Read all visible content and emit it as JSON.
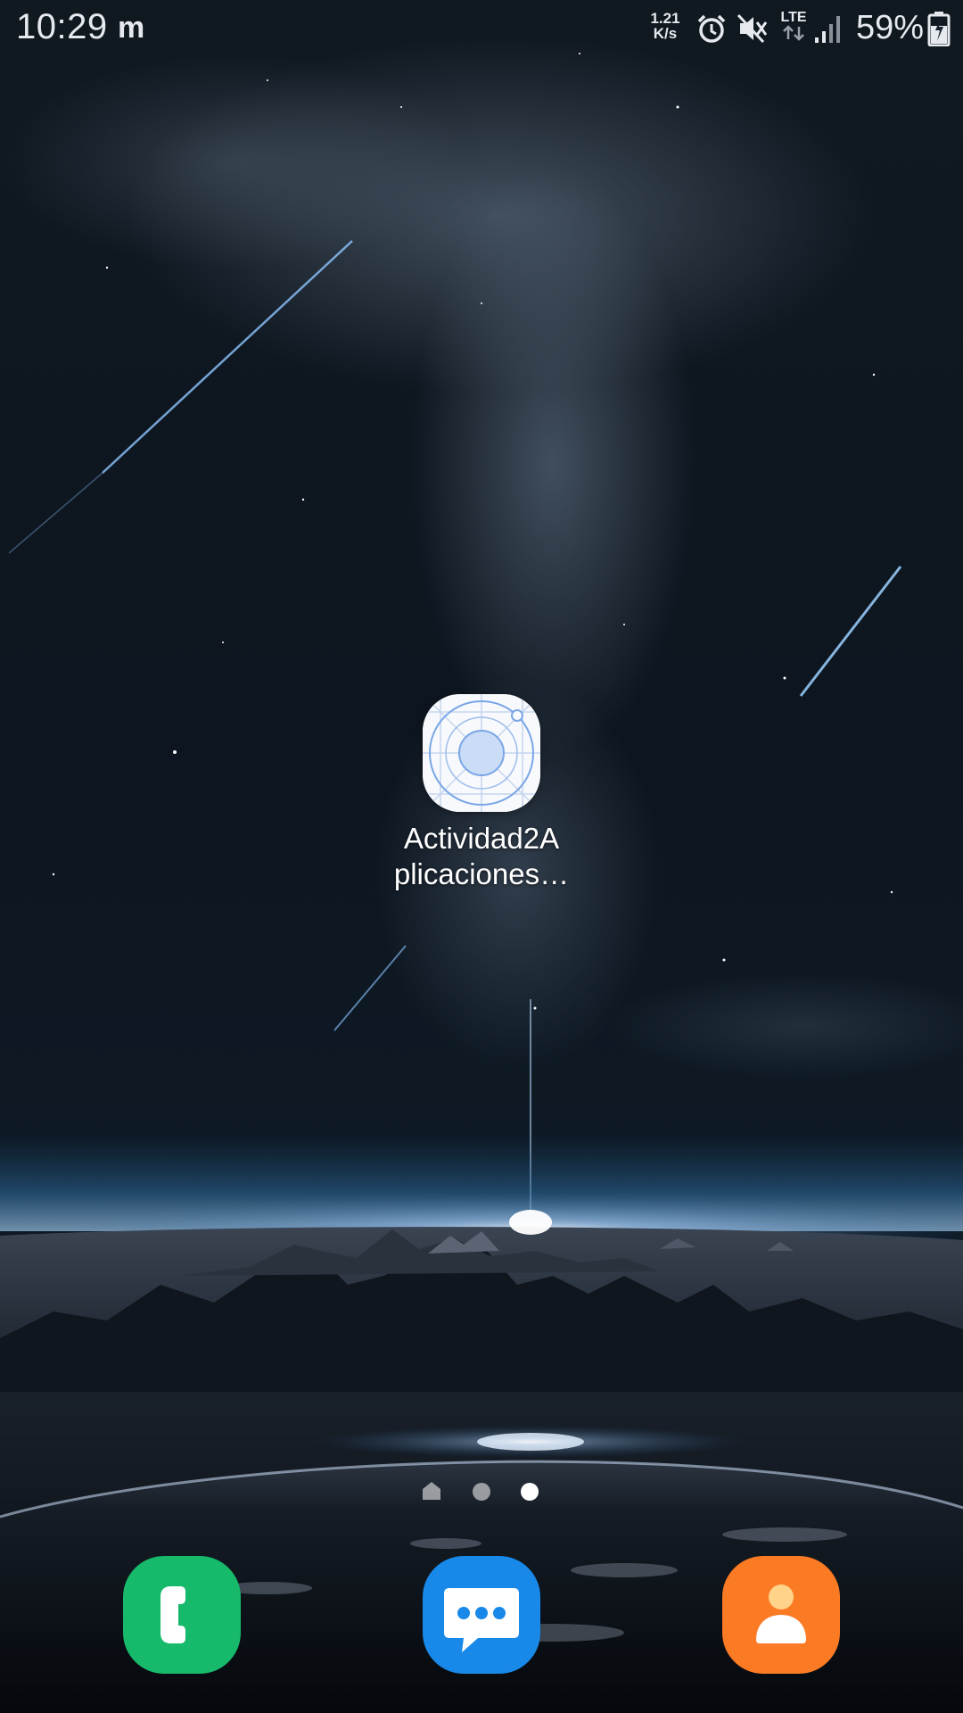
{
  "status_bar": {
    "time": "10:29",
    "left_icon": "m-notification-icon",
    "net_speed_value": "1.21",
    "net_speed_unit": "K/s",
    "icons": [
      "alarm-icon",
      "mute-icon",
      "lte-icon",
      "signal-icon",
      "battery-icon"
    ],
    "lte_label": "LTE",
    "battery_percent": "59%"
  },
  "home": {
    "app": {
      "icon": "app-radar-icon",
      "label_line1": "Actividad2A",
      "label_line2": "plicaciones…"
    },
    "page_indicator": {
      "pages": [
        "home",
        "page-2",
        "page-3"
      ],
      "active_index": 2
    }
  },
  "dock": {
    "apps": [
      {
        "name": "phone",
        "icon": "phone-icon",
        "color": "#17b96b"
      },
      {
        "name": "messages",
        "icon": "messages-icon",
        "color": "#1889e8"
      },
      {
        "name": "contacts",
        "icon": "contacts-icon",
        "color": "#fb7b25"
      }
    ]
  }
}
